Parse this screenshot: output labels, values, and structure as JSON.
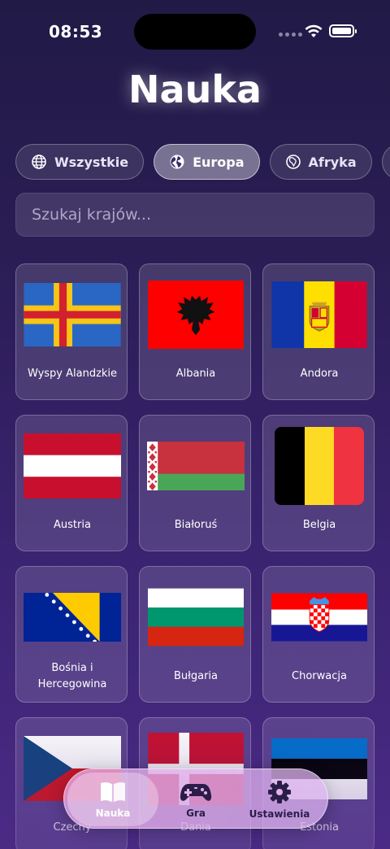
{
  "status": {
    "time": "08:53"
  },
  "header": {
    "title": "Nauka"
  },
  "chips": [
    {
      "label": "Wszystkie",
      "icon": "globe-icon",
      "active": false
    },
    {
      "label": "Europa",
      "icon": "globe-europe-icon",
      "active": true
    },
    {
      "label": "Afryka",
      "icon": "globe-africa-icon",
      "active": false
    },
    {
      "label": "",
      "icon": "globe-americas-icon",
      "active": false
    }
  ],
  "search": {
    "placeholder": "Szukaj krajów...",
    "value": ""
  },
  "countries": [
    {
      "name": "Wyspy Alandzkie",
      "flag": "aland"
    },
    {
      "name": "Albania",
      "flag": "albania"
    },
    {
      "name": "Andora",
      "flag": "andorra"
    },
    {
      "name": "Austria",
      "flag": "austria"
    },
    {
      "name": "Białoruś",
      "flag": "belarus"
    },
    {
      "name": "Belgia",
      "flag": "belgium"
    },
    {
      "name": "Bośnia i Hercegowina",
      "flag": "bosnia"
    },
    {
      "name": "Bułgaria",
      "flag": "bulgaria"
    },
    {
      "name": "Chorwacja",
      "flag": "croatia"
    },
    {
      "name": "Czechy",
      "flag": "czechia"
    },
    {
      "name": "Dania",
      "flag": "denmark"
    },
    {
      "name": "Estonia",
      "flag": "estonia"
    }
  ],
  "tabbar": {
    "items": [
      {
        "label": "Nauka",
        "icon": "book-icon",
        "active": true
      },
      {
        "label": "Gra",
        "icon": "gamepad-icon",
        "active": false
      },
      {
        "label": "Ustawienia",
        "icon": "gear-icon",
        "active": false
      }
    ]
  },
  "colors": {
    "accent": "#2b1d4a",
    "background_top": "#211a46",
    "background_bottom": "#4a2a85"
  }
}
